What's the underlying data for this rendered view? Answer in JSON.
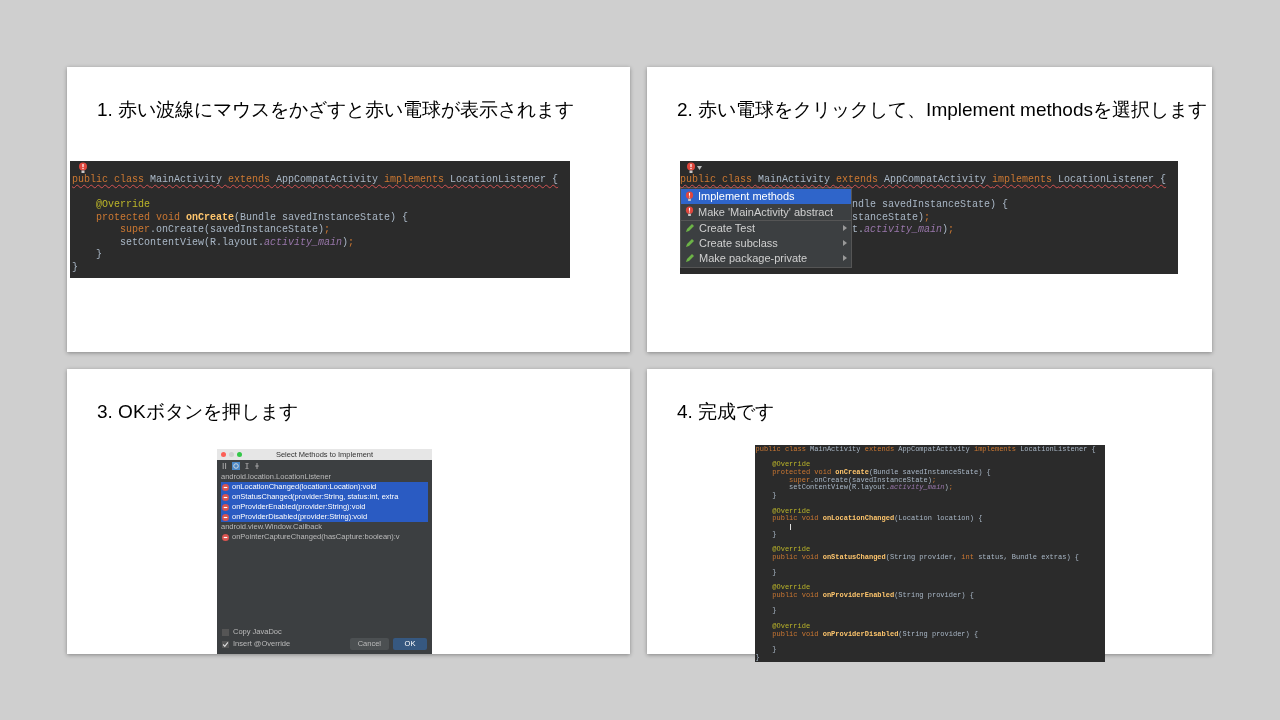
{
  "slides": [
    {
      "title": "1. 赤い波線にマウスをかざすと赤い電球が表示されます",
      "kind": "code",
      "lines": [
        {
          "kind": "code",
          "error": true,
          "tokens": [
            {
              "kind": "kw",
              "text": "public class "
            },
            {
              "kind": "plain",
              "text": "MainActivity "
            },
            {
              "kind": "kw",
              "text": "extends "
            },
            {
              "kind": "plain",
              "text": "AppCompatActivity "
            },
            {
              "kind": "kw",
              "text": "implements "
            },
            {
              "kind": "plain",
              "text": "LocationListener {"
            }
          ]
        },
        {
          "kind": "blank"
        },
        {
          "kind": "code",
          "tokens": [
            {
              "kind": "ann",
              "text": "    @Override"
            }
          ]
        },
        {
          "kind": "code",
          "tokens": [
            {
              "kind": "kw",
              "text": "    protected void "
            },
            {
              "kind": "fn",
              "text": "onCreate"
            },
            {
              "kind": "plain",
              "text": "(Bundle savedInstanceState) {"
            }
          ]
        },
        {
          "kind": "code",
          "tokens": [
            {
              "kind": "kw",
              "text": "        super"
            },
            {
              "kind": "plain",
              "text": ".onCreate(savedInstanceState)"
            },
            {
              "kind": "kw",
              "text": ";"
            }
          ]
        },
        {
          "kind": "code",
          "tokens": [
            {
              "kind": "plain",
              "text": "        setContentView(R.layout."
            },
            {
              "kind": "field",
              "text": "activity_main"
            },
            {
              "kind": "plain",
              "text": ")"
            },
            {
              "kind": "kw",
              "text": ";"
            }
          ]
        },
        {
          "kind": "code",
          "tokens": [
            {
              "kind": "plain",
              "text": "    }"
            }
          ]
        },
        {
          "kind": "code",
          "tokens": [
            {
              "kind": "plain",
              "text": "}"
            }
          ]
        }
      ]
    },
    {
      "title": "2. 赤い電球をクリックして、Implement methodsを選択します",
      "kind": "menu",
      "first_line": {
        "kind": "code",
        "error": true,
        "tokens": [
          {
            "kind": "kw",
            "text": "public class "
          },
          {
            "kind": "plain",
            "text": "MainActivity "
          },
          {
            "kind": "kw",
            "text": "extends "
          },
          {
            "kind": "plain",
            "text": "AppCompatActivity "
          },
          {
            "kind": "kw",
            "text": "implements "
          },
          {
            "kind": "plain",
            "text": "LocationListener {"
          }
        ]
      },
      "menu": [
        {
          "label": "Implement methods",
          "kind": "fix",
          "submenu": false,
          "selected": true
        },
        {
          "label": "Make 'MainActivity' abstract",
          "kind": "fix",
          "submenu": false,
          "selected": false
        },
        {
          "label": "Create Test",
          "kind": "action",
          "submenu": true,
          "selected": false
        },
        {
          "label": "Create subclass",
          "kind": "action",
          "submenu": true,
          "selected": false
        },
        {
          "label": "Make package-private",
          "kind": "action",
          "submenu": true,
          "selected": false
        }
      ],
      "side_lines": [
        {
          "kind": "blank"
        },
        {
          "kind": "code",
          "tokens": [
            {
              "kind": "plain",
              "text": "ndle savedInstanceState) {"
            }
          ]
        },
        {
          "kind": "code",
          "tokens": [
            {
              "kind": "plain",
              "text": "stanceState)"
            },
            {
              "kind": "kw",
              "text": ";"
            }
          ]
        },
        {
          "kind": "code",
          "tokens": [
            {
              "kind": "plain",
              "text": "t."
            },
            {
              "kind": "field",
              "text": "activity_main"
            },
            {
              "kind": "plain",
              "text": ")"
            },
            {
              "kind": "kw",
              "text": ";"
            }
          ]
        }
      ]
    },
    {
      "title": "3. OKボタンを押します",
      "kind": "dialog",
      "dialog": {
        "title": "Select Methods to Implement",
        "groups": [
          {
            "label": "android.location.LocationListener",
            "items": [
              {
                "label": "onLocationChanged(location:Location):void",
                "selected": true
              },
              {
                "label": "onStatusChanged(provider:String, status:int, extra",
                "selected": true
              },
              {
                "label": "onProviderEnabled(provider:String):void",
                "selected": true
              },
              {
                "label": "onProviderDisabled(provider:String):void",
                "selected": true
              }
            ]
          },
          {
            "label": "android.view.Window.Callback",
            "items": [
              {
                "label": "onPointerCaptureChanged(hasCapture:boolean):v",
                "selected": false
              }
            ]
          }
        ],
        "options": [
          {
            "label": "Copy JavaDoc",
            "checked": false
          },
          {
            "label": "Insert @Override",
            "checked": true
          }
        ],
        "buttons": [
          {
            "label": "Cancel",
            "default": false
          },
          {
            "label": "OK",
            "default": true
          }
        ]
      }
    },
    {
      "title": "4. 完成です",
      "kind": "code_small",
      "lines": [
        {
          "kind": "code",
          "tokens": [
            {
              "kind": "kw",
              "text": "public class "
            },
            {
              "kind": "plain",
              "text": "MainActivity "
            },
            {
              "kind": "kw",
              "text": "extends "
            },
            {
              "kind": "plain",
              "text": "AppCompatActivity "
            },
            {
              "kind": "kw",
              "text": "implements "
            },
            {
              "kind": "plain",
              "text": "LocationListener {"
            }
          ]
        },
        {
          "kind": "blank"
        },
        {
          "kind": "code",
          "tokens": [
            {
              "kind": "ann",
              "text": "    @Override"
            }
          ]
        },
        {
          "kind": "code",
          "tokens": [
            {
              "kind": "kw",
              "text": "    protected void "
            },
            {
              "kind": "fn",
              "text": "onCreate"
            },
            {
              "kind": "plain",
              "text": "(Bundle savedInstanceState) {"
            }
          ]
        },
        {
          "kind": "code",
          "tokens": [
            {
              "kind": "kw",
              "text": "        super"
            },
            {
              "kind": "plain",
              "text": ".onCreate(savedInstanceState)"
            },
            {
              "kind": "kw",
              "text": ";"
            }
          ]
        },
        {
          "kind": "code",
          "tokens": [
            {
              "kind": "plain",
              "text": "        setContentView(R.layout."
            },
            {
              "kind": "field",
              "text": "activity_main"
            },
            {
              "kind": "plain",
              "text": ")"
            },
            {
              "kind": "kw",
              "text": ";"
            }
          ]
        },
        {
          "kind": "code",
          "tokens": [
            {
              "kind": "plain",
              "text": "    }"
            }
          ]
        },
        {
          "kind": "blank"
        },
        {
          "kind": "code",
          "tokens": [
            {
              "kind": "ann",
              "text": "    @Override"
            }
          ]
        },
        {
          "kind": "code",
          "tokens": [
            {
              "kind": "kw",
              "text": "    public void "
            },
            {
              "kind": "fn",
              "text": "onLocationChanged"
            },
            {
              "kind": "plain",
              "text": "(Location location) {"
            }
          ]
        },
        {
          "kind": "caret"
        },
        {
          "kind": "code",
          "tokens": [
            {
              "kind": "plain",
              "text": "    }"
            }
          ]
        },
        {
          "kind": "blank"
        },
        {
          "kind": "code",
          "tokens": [
            {
              "kind": "ann",
              "text": "    @Override"
            }
          ]
        },
        {
          "kind": "code",
          "tokens": [
            {
              "kind": "kw",
              "text": "    public void "
            },
            {
              "kind": "fn",
              "text": "onStatusChanged"
            },
            {
              "kind": "plain",
              "text": "(String provider, "
            },
            {
              "kind": "kw",
              "text": "int "
            },
            {
              "kind": "plain",
              "text": "status, Bundle extras) {"
            }
          ]
        },
        {
          "kind": "blank"
        },
        {
          "kind": "code",
          "tokens": [
            {
              "kind": "plain",
              "text": "    }"
            }
          ]
        },
        {
          "kind": "blank"
        },
        {
          "kind": "code",
          "tokens": [
            {
              "kind": "ann",
              "text": "    @Override"
            }
          ]
        },
        {
          "kind": "code",
          "tokens": [
            {
              "kind": "kw",
              "text": "    public void "
            },
            {
              "kind": "fn",
              "text": "onProviderEnabled"
            },
            {
              "kind": "plain",
              "text": "(String provider) {"
            }
          ]
        },
        {
          "kind": "blank"
        },
        {
          "kind": "code",
          "tokens": [
            {
              "kind": "plain",
              "text": "    }"
            }
          ]
        },
        {
          "kind": "blank"
        },
        {
          "kind": "code",
          "tokens": [
            {
              "kind": "ann",
              "text": "    @Override"
            }
          ]
        },
        {
          "kind": "code",
          "tokens": [
            {
              "kind": "kw",
              "text": "    public void "
            },
            {
              "kind": "fn",
              "text": "onProviderDisabled"
            },
            {
              "kind": "plain",
              "text": "(String provider) {"
            }
          ]
        },
        {
          "kind": "blank"
        },
        {
          "kind": "code",
          "tokens": [
            {
              "kind": "plain",
              "text": "    }"
            }
          ]
        },
        {
          "kind": "code",
          "tokens": [
            {
              "kind": "plain",
              "text": "}"
            }
          ]
        }
      ]
    }
  ]
}
